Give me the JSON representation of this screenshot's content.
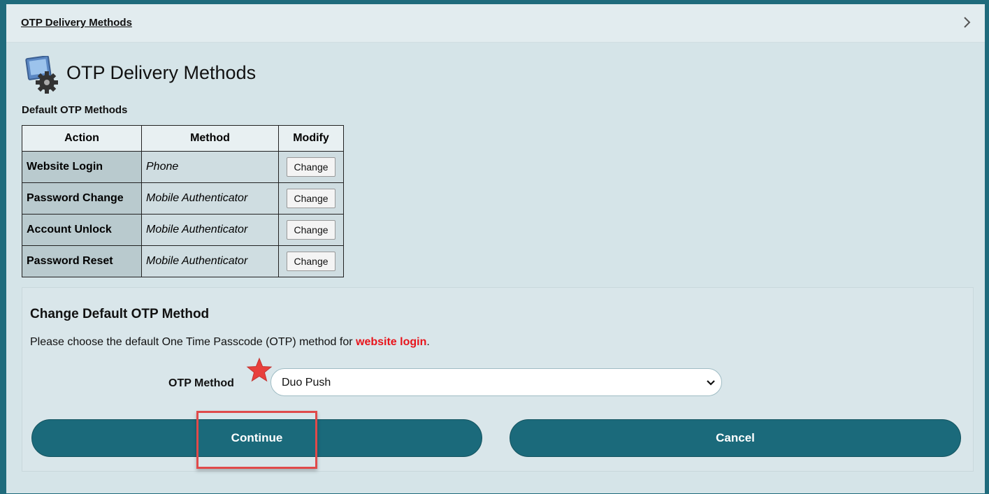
{
  "breadcrumb": {
    "link_label": "OTP Delivery Methods"
  },
  "page": {
    "title": "OTP Delivery Methods"
  },
  "default_methods": {
    "heading": "Default OTP Methods",
    "columns": [
      "Action",
      "Method",
      "Modify"
    ],
    "rows": [
      {
        "action": "Website Login",
        "method": "Phone",
        "button": "Change"
      },
      {
        "action": "Password Change",
        "method": "Mobile Authenticator",
        "button": "Change"
      },
      {
        "action": "Account Unlock",
        "method": "Mobile Authenticator",
        "button": "Change"
      },
      {
        "action": "Password Reset",
        "method": "Mobile Authenticator",
        "button": "Change"
      }
    ]
  },
  "change_form": {
    "heading": "Change Default OTP Method",
    "description_before": "Please choose the default One Time Passcode (OTP) method for ",
    "description_highlight": "website login",
    "description_after": ".",
    "otp_label": "OTP Method",
    "otp_selected": "Duo Push",
    "continue_label": "Continue",
    "cancel_label": "Cancel"
  },
  "icons": {
    "chevron": "chevron-right-icon",
    "title": "settings-gear-icon",
    "marker": "star-icon",
    "select": "chevron-down-icon"
  },
  "colors": {
    "accent": "#1b6a7b",
    "highlight_text": "#e8141b",
    "annotation": "#e04a4a"
  }
}
